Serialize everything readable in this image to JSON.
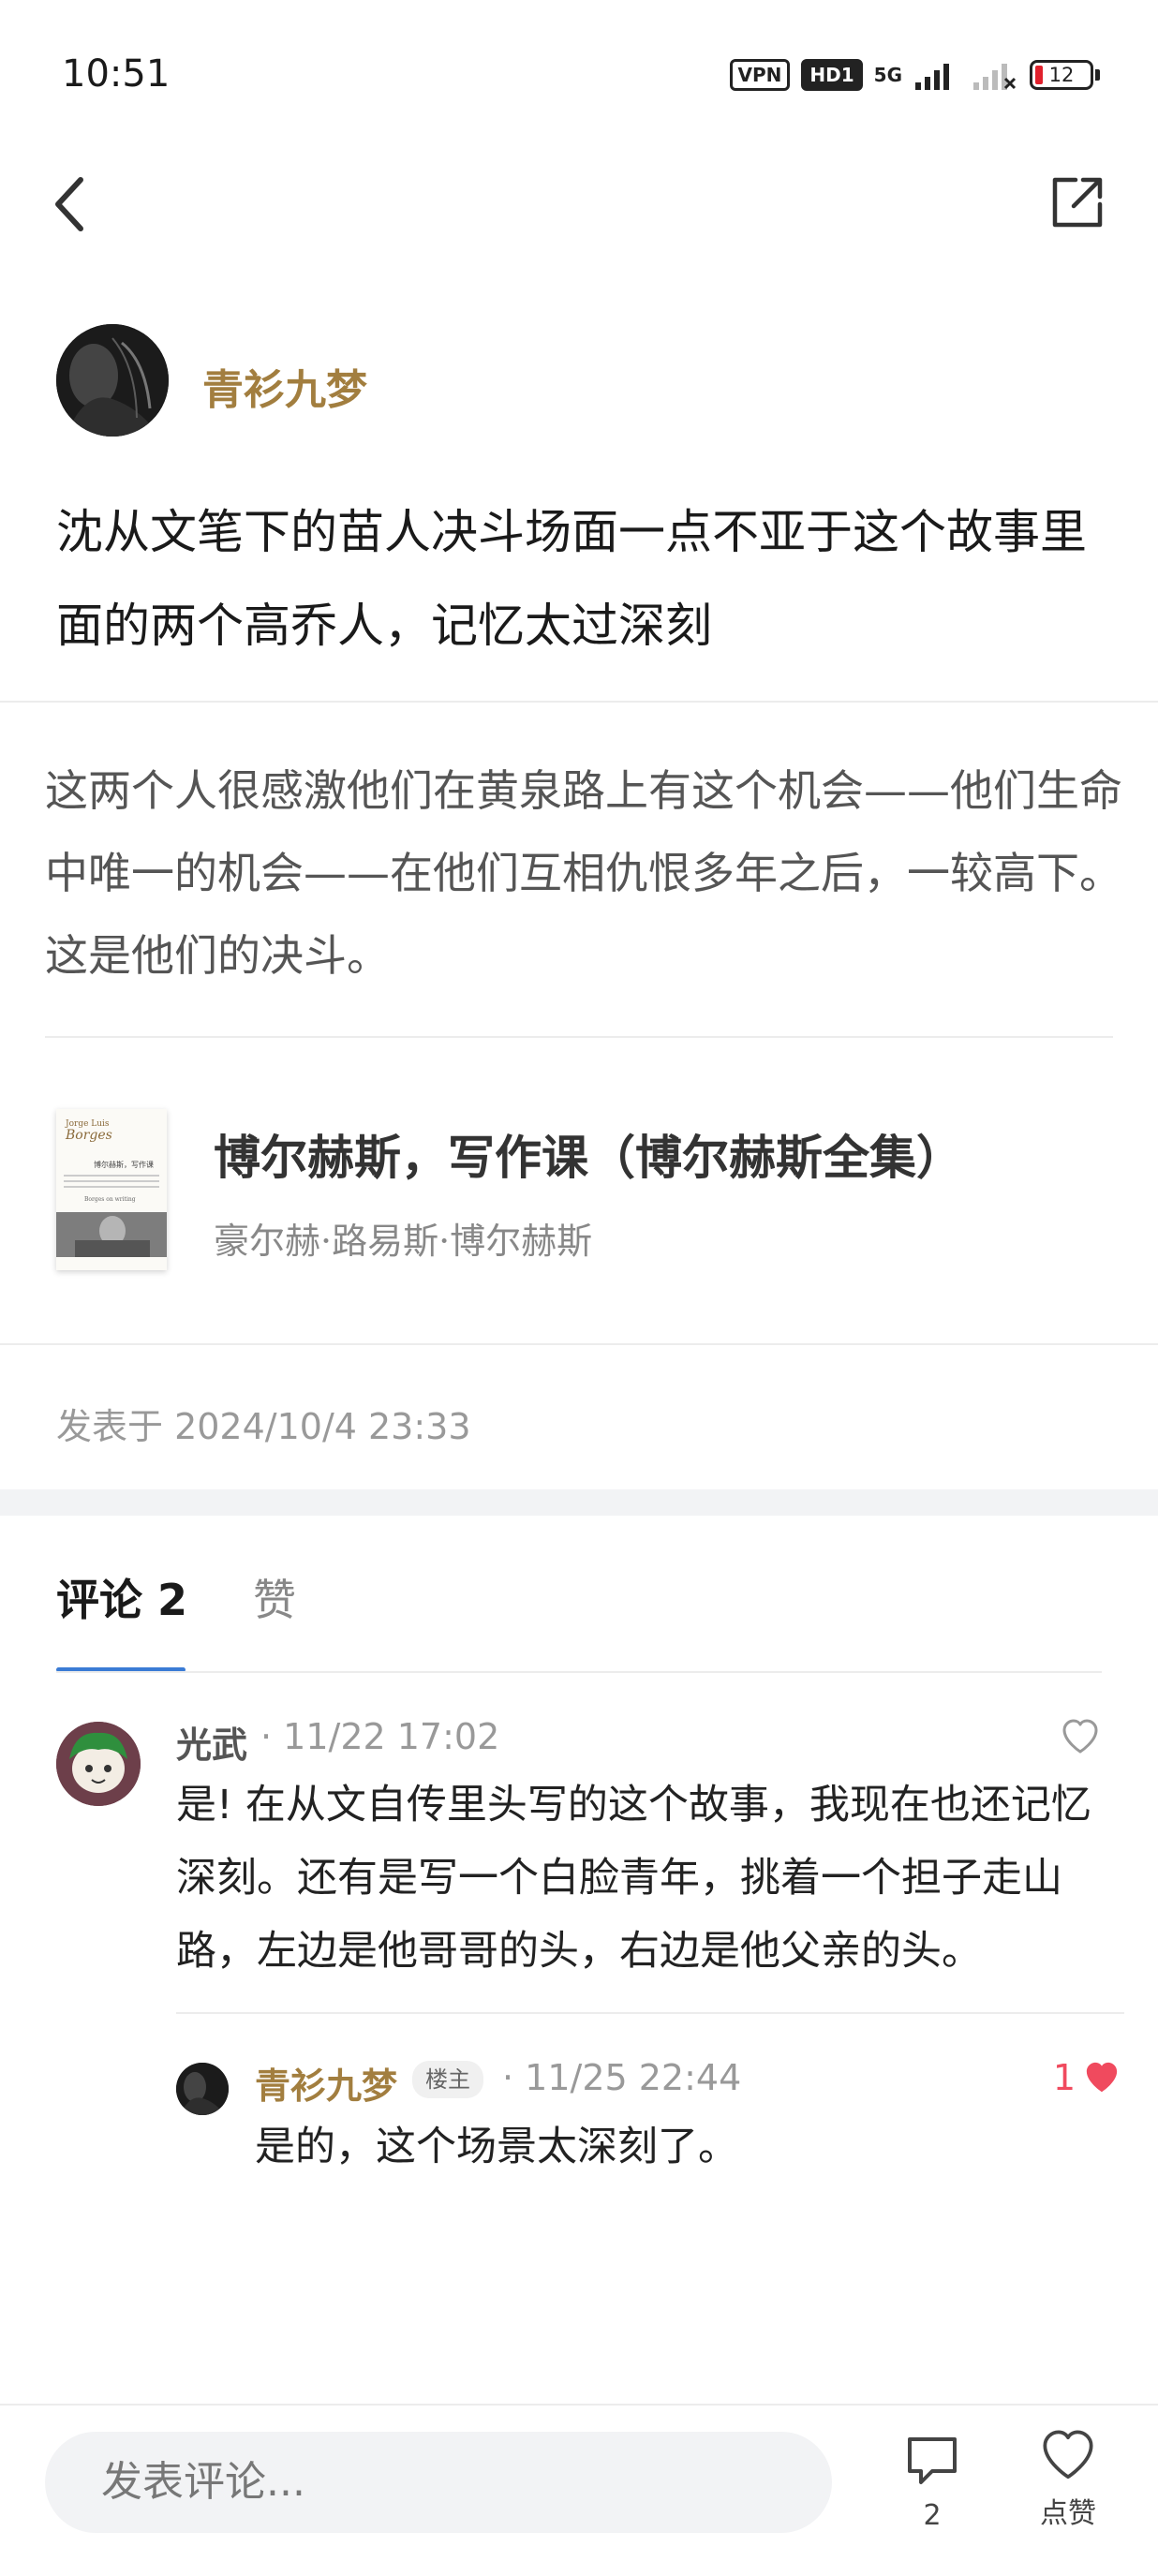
{
  "status_bar": {
    "time": "10:51",
    "vpn_badge": "VPN",
    "hd_badge": "HD1",
    "network": "5G",
    "battery": "12",
    "battery_color": "#e0202c"
  },
  "nav": {
    "back_icon": "chevron-left-icon",
    "share_icon": "share-external-icon"
  },
  "post": {
    "author_name": "青衫九梦",
    "title": "沈从文笔下的苗人决斗场面一点不亚于这个故事里面的两个高乔人，记忆太过深刻",
    "quote": "这两个人很感激他们在黄泉路上有这个机会——他们生命中唯一的机会——在他们互相仇恨多年之后，一较高下。这是他们的决斗。",
    "book": {
      "cover_author": "Jorge Luis",
      "cover_brand": "Borges",
      "cover_title": "博尔赫斯，写作课",
      "cover_subtitle": "Borges on writing",
      "title": "博尔赫斯，写作课（博尔赫斯全集）",
      "author": "豪尔赫·路易斯·博尔赫斯"
    },
    "publish_time": "发表于 2024/10/4 23:33"
  },
  "tabs": {
    "comments": "评论 2",
    "likes": "赞",
    "active_color": "#3a7bd5"
  },
  "comments": [
    {
      "name": "光武",
      "time": "· 11/22 17:02",
      "text": "是! 在从文自传里头写的这个故事，我现在也还记忆深刻。还有是写一个白脸青年，挑着一个担子走山路，左边是他哥哥的头，右边是他父亲的头。",
      "liked": false
    }
  ],
  "reply": {
    "name": "青衫九梦",
    "badge": "楼主",
    "time": "· 11/25 22:44",
    "text": "是的，这个场景太深刻了。",
    "like_count": "1",
    "like_color": "#f04a5e"
  },
  "bottom_bar": {
    "input_placeholder": "发表评论...",
    "comment_count": "2",
    "like_label": "点赞"
  },
  "colors": {
    "author_name": "#a27e3f"
  }
}
